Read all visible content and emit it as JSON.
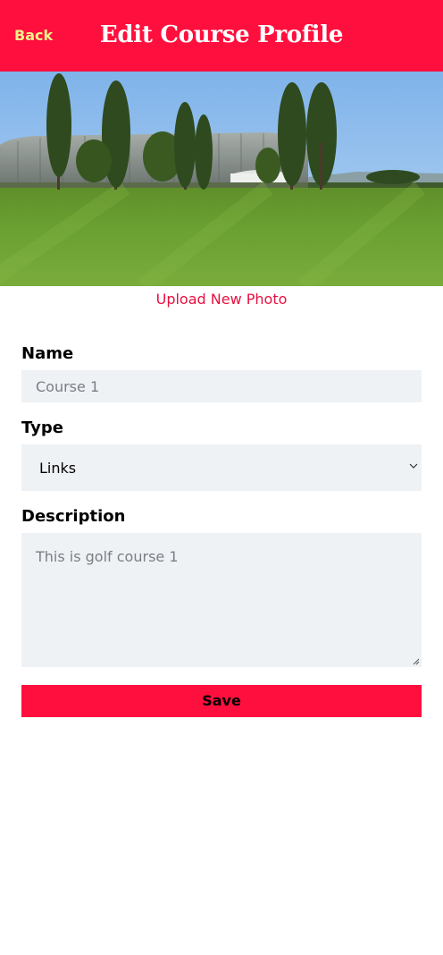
{
  "header": {
    "back_label": "Back",
    "title": "Edit Course Profile",
    "background": "#ff0f3d",
    "back_color": "#f2f08a"
  },
  "photo": {
    "subject": "golf course fairway with poplar trees and hangar"
  },
  "upload_label": "Upload New Photo",
  "form": {
    "name": {
      "label": "Name",
      "placeholder": "Course 1"
    },
    "type": {
      "label": "Type",
      "value": "Links"
    },
    "description": {
      "label": "Description",
      "placeholder": "This is golf course 1"
    },
    "save_label": "Save"
  },
  "colors": {
    "accent": "#ff0f3d",
    "field_bg": "#eff2f5",
    "placeholder": "#7a7f86"
  }
}
